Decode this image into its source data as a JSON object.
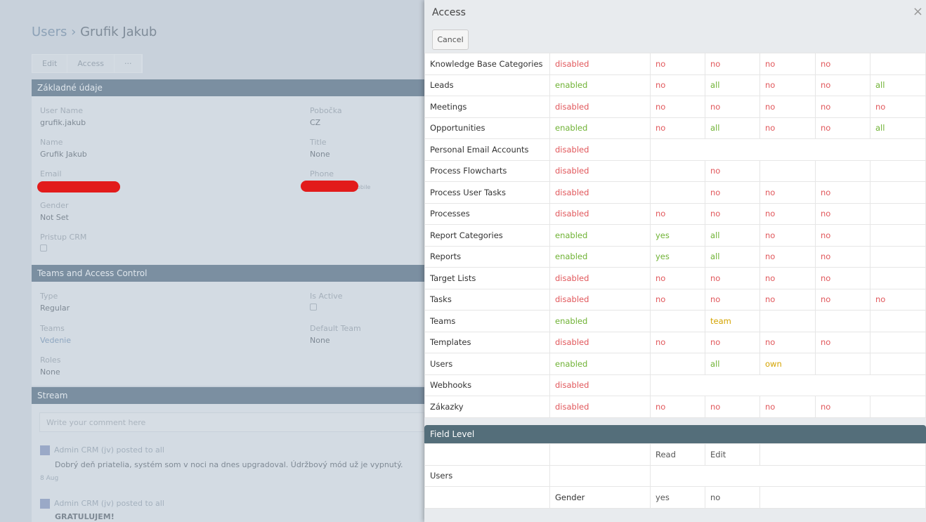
{
  "background_page": {
    "breadcrumb": {
      "parent": "Users",
      "separator": "›",
      "current": "Grufik Jakub"
    },
    "buttons": {
      "edit": "Edit",
      "access": "Access",
      "more": "···"
    },
    "sections": {
      "basic": "Základné údaje",
      "teams": "Teams and Access Control",
      "stream": "Stream"
    },
    "fields": {
      "user_name": {
        "label": "User Name",
        "value": "grufik.jakub"
      },
      "pobocka": {
        "label": "Pobočka",
        "value": "CZ"
      },
      "name": {
        "label": "Name",
        "value": "Grufik Jakub"
      },
      "title": {
        "label": "Title",
        "value": "None"
      },
      "email": {
        "label": "Email"
      },
      "phone": {
        "label": "Phone",
        "suffix": "obile"
      },
      "gender": {
        "label": "Gender",
        "value": "Not Set"
      },
      "pristup": {
        "label": "Pristup CRM"
      },
      "type": {
        "label": "Type",
        "value": "Regular"
      },
      "is_active": {
        "label": "Is Active"
      },
      "teams": {
        "label": "Teams",
        "value": "Vedenie"
      },
      "default_team": {
        "label": "Default Team",
        "value": "None"
      },
      "roles": {
        "label": "Roles",
        "value": "None"
      }
    },
    "comment_placeholder": "Write your comment here",
    "posts": [
      {
        "author": "Admin CRM (jv) posted to all",
        "text": "Dobrý deň priatelia, systém som v noci na dnes upgradoval. Údržbový mód už je vypnutý.",
        "date": "8 Aug"
      },
      {
        "author": "Admin CRM (jv) posted to all",
        "text": "GRATULUJEM!"
      }
    ]
  },
  "modal": {
    "title": "Access",
    "close": "×",
    "cancel": "Cancel",
    "rows": [
      {
        "name": "Knowledge Base Categories",
        "status": "disabled",
        "cells": [
          "no",
          "no",
          "no",
          "no",
          ""
        ]
      },
      {
        "name": "Leads",
        "status": "enabled",
        "cells": [
          "no",
          "all",
          "no",
          "no",
          "all"
        ]
      },
      {
        "name": "Meetings",
        "status": "disabled",
        "cells": [
          "no",
          "no",
          "no",
          "no",
          "no"
        ]
      },
      {
        "name": "Opportunities",
        "status": "enabled",
        "cells": [
          "no",
          "all",
          "no",
          "no",
          "all"
        ]
      },
      {
        "name": "Personal Email Accounts",
        "status": "disabled",
        "span": true
      },
      {
        "name": "Process Flowcharts",
        "status": "disabled",
        "cells": [
          "",
          "no",
          "",
          "",
          ""
        ]
      },
      {
        "name": "Process User Tasks",
        "status": "disabled",
        "cells": [
          "",
          "no",
          "no",
          "no",
          ""
        ]
      },
      {
        "name": "Processes",
        "status": "disabled",
        "cells": [
          "no",
          "no",
          "no",
          "no",
          ""
        ]
      },
      {
        "name": "Report Categories",
        "status": "enabled",
        "cells": [
          "yes",
          "all",
          "no",
          "no",
          ""
        ]
      },
      {
        "name": "Reports",
        "status": "enabled",
        "cells": [
          "yes",
          "all",
          "no",
          "no",
          ""
        ]
      },
      {
        "name": "Target Lists",
        "status": "disabled",
        "cells": [
          "no",
          "no",
          "no",
          "no",
          ""
        ]
      },
      {
        "name": "Tasks",
        "status": "disabled",
        "cells": [
          "no",
          "no",
          "no",
          "no",
          "no"
        ]
      },
      {
        "name": "Teams",
        "status": "enabled",
        "cells": [
          "",
          "team",
          "",
          "",
          ""
        ]
      },
      {
        "name": "Templates",
        "status": "disabled",
        "cells": [
          "no",
          "no",
          "no",
          "no",
          ""
        ]
      },
      {
        "name": "Users",
        "status": "enabled",
        "cells": [
          "",
          "all",
          "own",
          "",
          ""
        ]
      },
      {
        "name": "Webhooks",
        "status": "disabled",
        "span": true
      },
      {
        "name": "Zákazky",
        "status": "disabled",
        "cells": [
          "no",
          "no",
          "no",
          "no",
          ""
        ]
      }
    ],
    "field_level": {
      "title": "Field Level",
      "headers": {
        "read": "Read",
        "edit": "Edit"
      },
      "scope": "Users",
      "field": "Gender",
      "read": "yes",
      "edit": "no"
    }
  },
  "colors": {
    "green": "#6fb234",
    "red": "#e1575b",
    "yellow": "#d4a300"
  }
}
